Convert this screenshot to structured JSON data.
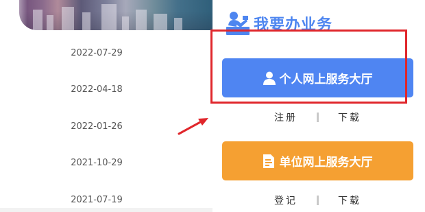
{
  "news_dates": [
    "2022-07-29",
    "2022-04-18",
    "2022-01-26",
    "2021-10-29",
    "2021-07-19"
  ],
  "panel": {
    "title": "我要办业务",
    "personal_hall": {
      "label": "个人网上服务大厅",
      "links": [
        "注册",
        "下载"
      ]
    },
    "unit_hall": {
      "label": "单位网上服务大厅",
      "links": [
        "登记",
        "下载"
      ]
    }
  },
  "colors": {
    "accent_blue": "#4f85f2",
    "accent_orange": "#f5a032",
    "annotation_red": "#e0262b"
  },
  "icons": {
    "title": "service-desk-icon",
    "personal": "person-icon",
    "unit": "document-icon"
  }
}
